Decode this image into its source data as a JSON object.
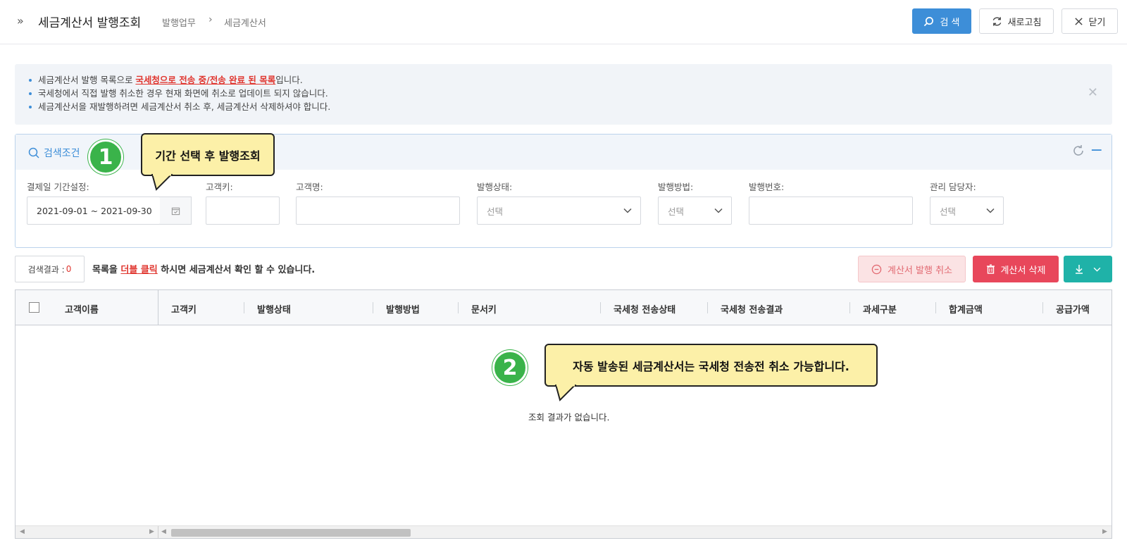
{
  "header": {
    "title": "세금계산서 발행조회",
    "breadcrumb": [
      "발행업무",
      "세금계산서"
    ],
    "buttons": {
      "search": "검 색",
      "refresh": "새로고침",
      "close": "닫기"
    }
  },
  "notice": {
    "line1_prefix": "세금계산서 발행 목록으로 ",
    "line1_highlight": "국세청으로 전송 중/전송 완료 된 목록",
    "line1_suffix": "입니다.",
    "line2": "국세청에서 직접 발행 취소한 경우 현재 화면에 취소로 업데이트 되지 않습니다.",
    "line3": "세금계산서을 재발행하려면 세금계산서 취소 후, 세금계산서 삭제하셔야 합니다."
  },
  "search_panel": {
    "title": "검색조건",
    "fields": {
      "period_label": "결제일 기간설정:",
      "period_value": "2021-09-01 ~ 2021-09-30",
      "customer_key_label": "고객키:",
      "customer_name_label": "고객명:",
      "issue_status_label": "발행상태:",
      "issue_status_value": "선택",
      "issue_method_label": "발행방법:",
      "issue_method_value": "선택",
      "issue_number_label": "발행번호:",
      "manager_label": "관리 담당자:",
      "manager_value": "선택"
    }
  },
  "results": {
    "count_label": "검색결과 :",
    "count_value": "0",
    "hint_prefix": "목록을 ",
    "hint_highlight": "더블 클릭",
    "hint_suffix": " 하시면 세금계산서 확인 할 수 있습니다.",
    "cancel_issue_button": "계산서 발행 취소",
    "delete_button": "계산서 삭제"
  },
  "grid": {
    "columns": [
      "고객이름",
      "고객키",
      "발행상태",
      "발행방법",
      "문서키",
      "국세청 전송상태",
      "국세청 전송결과",
      "과세구분",
      "합계금액",
      "공급가액"
    ],
    "empty_message": "조회 결과가 없습니다."
  },
  "tutorial": {
    "step1_number": "1",
    "step1_text": "기간 선택 후 발행조회",
    "step2_number": "2",
    "step2_text": "자동 발송된 세금계산서는 국세청 전송전 취소 가능합니다."
  },
  "colors": {
    "primary": "#3d8ed8",
    "danger": "#e8475b",
    "teal": "#1fb2a8",
    "highlight_red": "#e0362f",
    "step_green": "#3ab34a",
    "callout_yellow": "#fcf0a8"
  }
}
